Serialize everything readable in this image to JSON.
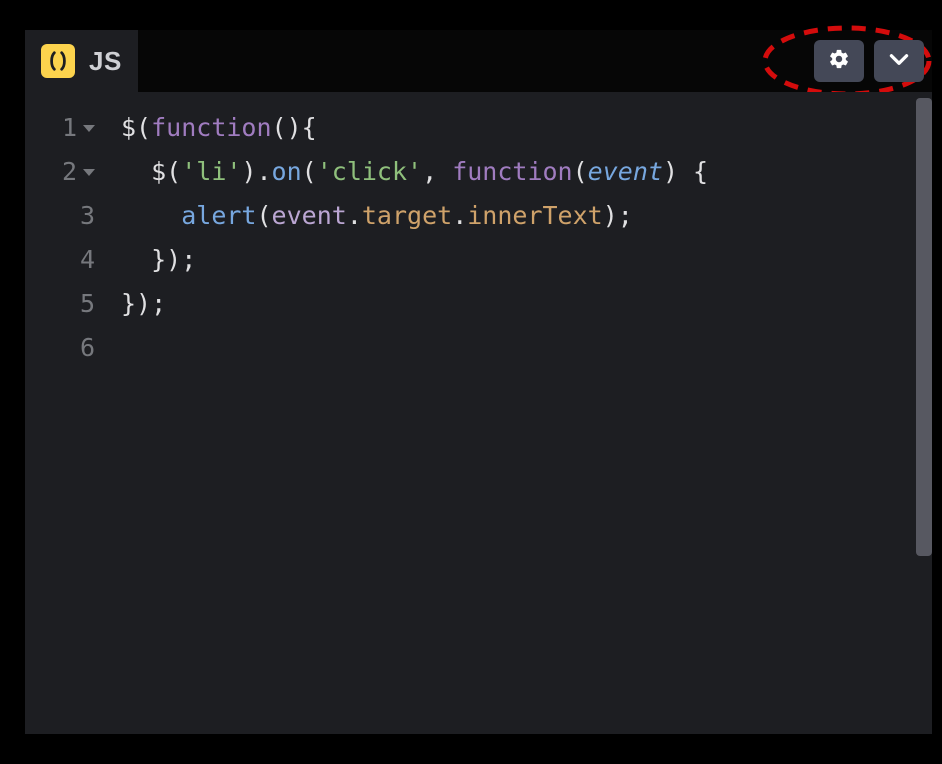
{
  "header": {
    "tab_label": "JS",
    "logo_icon": "parentheses-icon"
  },
  "actions": {
    "settings": "gear-icon",
    "collapse": "chevron-down-icon"
  },
  "gutter": {
    "lines": [
      {
        "num": "1",
        "foldable": true
      },
      {
        "num": "2",
        "foldable": true
      },
      {
        "num": "3",
        "foldable": false
      },
      {
        "num": "4",
        "foldable": false
      },
      {
        "num": "5",
        "foldable": false
      },
      {
        "num": "6",
        "foldable": false
      }
    ]
  },
  "code": {
    "line1": {
      "t1": "$(",
      "t2": "function",
      "t3": "(){"
    },
    "line2": {
      "indent": "  ",
      "t1": "$(",
      "t2": "'li'",
      "t3": ").",
      "t4": "on",
      "t5": "(",
      "t6": "'click'",
      "t7": ", ",
      "t8": "function",
      "t9": "(",
      "t10": "event",
      "t11": ") {"
    },
    "line3": {
      "indent": "    ",
      "t1": "alert",
      "t2": "(",
      "t3": "event",
      "t4": ".",
      "t5": "target",
      "t6": ".",
      "t7": "innerText",
      "t8": ");"
    },
    "line4": {
      "indent": "  ",
      "t1": "});"
    },
    "line5": {
      "t1": "});"
    }
  }
}
